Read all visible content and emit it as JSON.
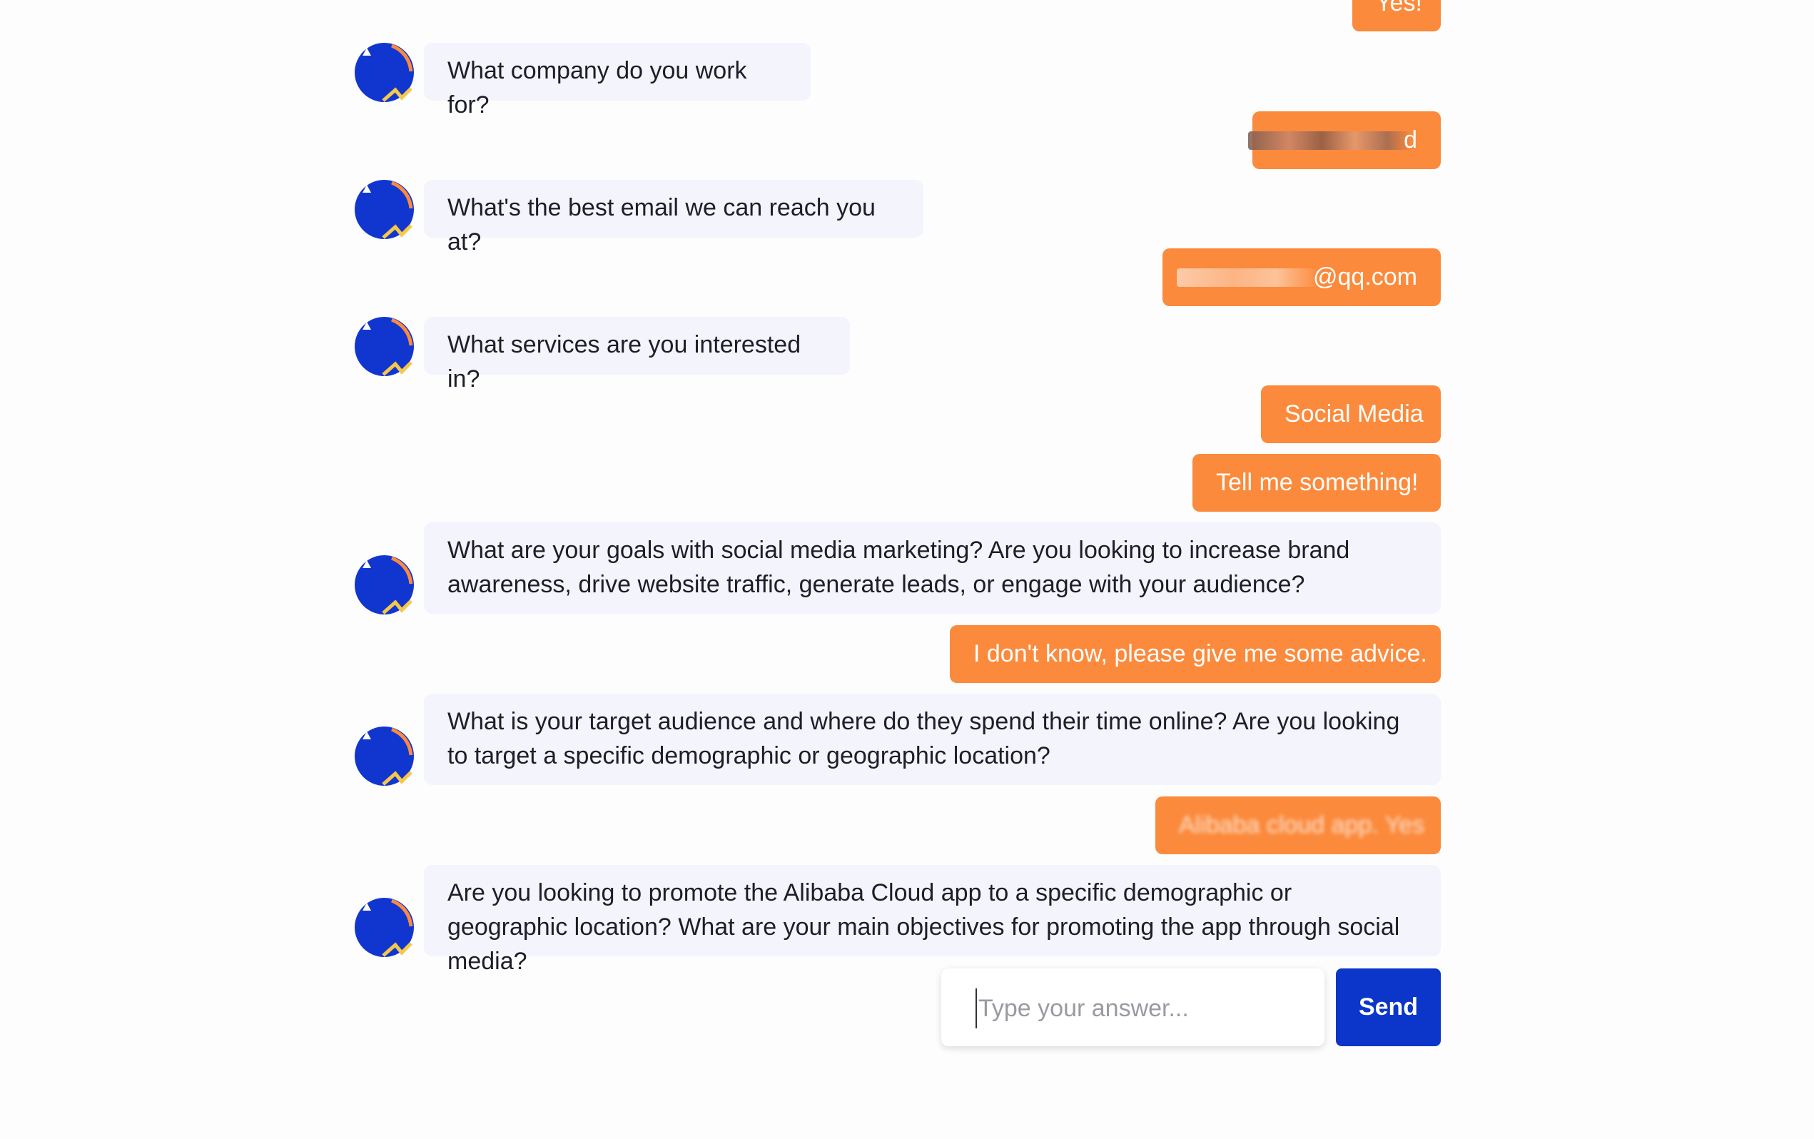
{
  "theme": {
    "user_bubble_color": "#fb8a3c",
    "bot_bubble_color": "#f3f4fc",
    "send_button_color": "#0b36c9",
    "avatar_color": "#1136d0"
  },
  "messages": [
    {
      "from": "user",
      "text": "Yes!"
    },
    {
      "from": "bot",
      "text": "What company do you work for?"
    },
    {
      "from": "user",
      "text": "d",
      "redacted": true
    },
    {
      "from": "bot",
      "text": "What's the best email we can reach you at?"
    },
    {
      "from": "user",
      "text": "@qq.com",
      "redacted": true
    },
    {
      "from": "bot",
      "text": "What services are you interested in?"
    },
    {
      "from": "user",
      "text": "Social Media"
    },
    {
      "from": "user",
      "text": "Tell me something!"
    },
    {
      "from": "bot",
      "text": "What are your goals with social media marketing? Are you looking to increase brand awareness, drive website traffic, generate leads, or engage with your audience?"
    },
    {
      "from": "user",
      "text": "I don't know, please give me some advice."
    },
    {
      "from": "bot",
      "text": "What is your target audience and where do they spend their time online? Are you looking to target a specific demographic or geographic location?"
    },
    {
      "from": "user",
      "text": "Alibaba cloud app. Yes",
      "redacted": true
    },
    {
      "from": "bot",
      "text": "Are you looking to promote the Alibaba Cloud app to a specific demographic or geographic location? What are your main objectives for promoting the app through social media?"
    }
  ],
  "composer": {
    "placeholder": "Type your answer...",
    "value": "",
    "send_label": "Send"
  }
}
